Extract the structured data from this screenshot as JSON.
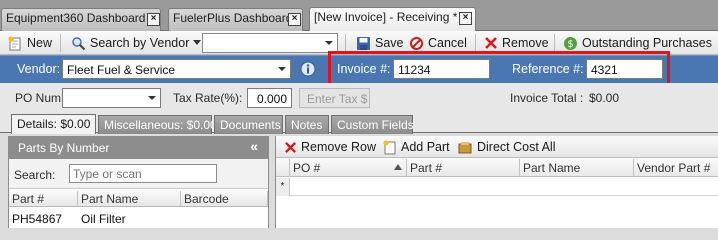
{
  "doc_tabs": [
    {
      "label": "Equipment360 Dashboard",
      "close": "×"
    },
    {
      "label": "FuelerPlus Dashboard",
      "close": "×"
    },
    {
      "label": "[New Invoice] - Receiving *",
      "close": "×"
    }
  ],
  "toolbar": {
    "new_label": "New",
    "search_by_vendor_label": "Search by Vendor",
    "vendor_select_value": "",
    "save_label": "Save",
    "cancel_label": "Cancel",
    "remove_label": "Remove",
    "outstanding_label": "Outstanding Purchases"
  },
  "header": {
    "vendor_label": "Vendor:",
    "vendor_value": "Fleet Fuel & Service",
    "invoice_label": "Invoice #:",
    "invoice_value": "11234",
    "reference_label": "Reference #:",
    "reference_value": "4321"
  },
  "row2": {
    "po_label": "PO Num:",
    "po_value": "",
    "tax_label": "Tax Rate(%):",
    "tax_value": "0.000",
    "enter_tax_label": "Enter Tax $",
    "invoice_total_label": "Invoice Total :",
    "invoice_total_value": "$0.00"
  },
  "subtabs": [
    {
      "label": "Details: $0.00"
    },
    {
      "label": "Miscellaneous: $0.00"
    },
    {
      "label": "Documents"
    },
    {
      "label": "Notes"
    },
    {
      "label": "Custom Fields"
    }
  ],
  "parts_panel": {
    "title": "Parts By Number",
    "collapse": "«",
    "search_label": "Search:",
    "search_placeholder": "Type or scan",
    "columns": [
      "Part #",
      "Part Name",
      "Barcode"
    ],
    "rows": [
      {
        "part": "PH54867",
        "name": "Oil Filter",
        "barcode": ""
      }
    ]
  },
  "line_items": {
    "remove_row_label": "Remove Row",
    "add_part_label": "Add Part",
    "direct_cost_label": "Direct Cost All",
    "columns": [
      "PO #",
      "Part #",
      "Part Name",
      "Vendor Part #"
    ],
    "new_row_marker": "*"
  },
  "colors": {
    "accent": "#4a76b2",
    "highlight": "#e2141b"
  }
}
